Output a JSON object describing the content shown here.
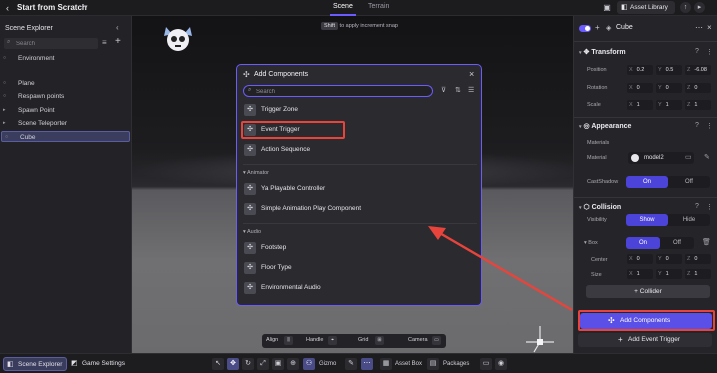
{
  "topbar": {
    "title": "Start from Scratch",
    "tabs": [
      "Scene",
      "Terrain"
    ],
    "asset_library": "Asset Library"
  },
  "hint": {
    "key": "Shift",
    "text": "to apply increment snap"
  },
  "left_panel": {
    "title": "Scene Explorer",
    "search_placeholder": "Search",
    "items": [
      "Environment",
      "Plane",
      "Respawn points",
      "Spawn Point",
      "Scene Teleporter",
      "Cube"
    ],
    "selected": "Cube"
  },
  "modal": {
    "title": "Add Components",
    "search_placeholder": "Search",
    "items": [
      "Trigger Zone",
      "Event Trigger",
      "Action Sequence"
    ],
    "groups": [
      {
        "label": "Animator",
        "items": [
          "Ya Playable Controller",
          "Simple Animation Play Component"
        ]
      },
      {
        "label": "Audio",
        "items": [
          "Footstep",
          "Floor Type",
          "Environmental Audio"
        ]
      }
    ],
    "highlighted": "Event Trigger"
  },
  "right_panel": {
    "object_name": "Cube",
    "transform": {
      "title": "Transform",
      "position_label": "Position",
      "position": [
        "0.2",
        "0.5",
        "-6.08"
      ],
      "rotation_label": "Rotation",
      "rotation": [
        "0",
        "0",
        "0"
      ],
      "scale_label": "Scale",
      "scale": [
        "1",
        "1",
        "1"
      ]
    },
    "appearance": {
      "title": "Appearance",
      "materials_label": "Materials",
      "material_label": "Material",
      "material_value": "model2",
      "castshadow_label": "CastShadow",
      "on": "On",
      "off": "Off"
    },
    "collision": {
      "title": "Collision",
      "visibility_label": "Visibility",
      "show": "Show",
      "hide": "Hide",
      "box_label": "Box",
      "on": "On",
      "off": "Off",
      "center_label": "Center",
      "center": [
        "0",
        "0",
        "0"
      ],
      "size_label": "Size",
      "size": [
        "1",
        "1",
        "1"
      ],
      "collider_button": "Collider"
    },
    "add_components_button": "Add Components",
    "add_event_trigger_button": "Add  Event Trigger"
  },
  "viewport_toolbar": {
    "align": "Align",
    "handle": "Handle",
    "grid": "Grid",
    "camera": "Camera"
  },
  "bottombar": {
    "scene_explorer": "Scene Explorer",
    "game_settings": "Game Settings",
    "gizmo": "Gizmo",
    "asset_box": "Asset Box",
    "packages": "Packages"
  },
  "colors": {
    "accent": "#6b5cff",
    "highlight_red": "#e8443c"
  }
}
